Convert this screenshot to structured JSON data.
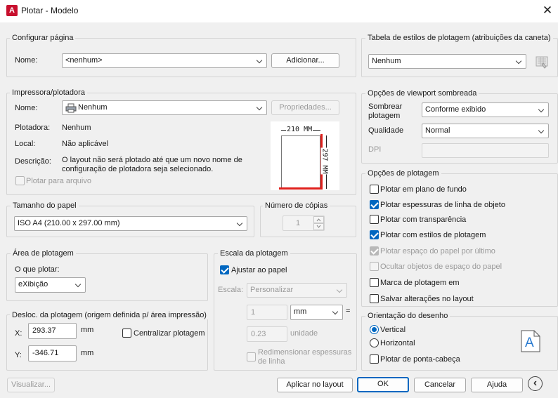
{
  "window": {
    "title": "Plotar - Modelo",
    "app_icon": "A",
    "close": "✕"
  },
  "page_setup": {
    "legend": "Configurar página",
    "name_label": "Nome:",
    "name_value": "<nenhum>",
    "add_button": "Adicionar..."
  },
  "printer": {
    "legend": "Impressora/plotadora",
    "name_label": "Nome:",
    "name_value": "Nenhum",
    "properties_button": "Propriedades...",
    "plotter_label": "Plotadora:",
    "plotter_value": "Nenhum",
    "location_label": "Local:",
    "location_value": "Não aplicável",
    "description_label": "Descrição:",
    "description_line1": "O layout não será plotado até que um novo nome de",
    "description_line2": "configuração de plotadora seja selecionado.",
    "plot_to_file": "Plotar para arquivo",
    "preview_width": "210 MM",
    "preview_height": "297 MM"
  },
  "paper_size": {
    "legend": "Tamanho do papel",
    "value": "ISO A4 (210.00 x 297.00 mm)"
  },
  "copies": {
    "legend": "Número de cópias",
    "value": "1"
  },
  "plot_area": {
    "legend": "Área de plotagem",
    "what_label": "O que plotar:",
    "what_value": "eXibição"
  },
  "offset": {
    "legend": "Desloc. da plotagem (origem definida p/ área impressão)",
    "x_label": "X:",
    "x_value": "293.37",
    "x_unit": "mm",
    "y_label": "Y:",
    "y_value": "-346.71",
    "y_unit": "mm",
    "center": "Centralizar plotagem"
  },
  "plot_scale": {
    "legend": "Escala da plotagem",
    "fit": "Ajustar ao papel",
    "fit_checked": true,
    "scale_label": "Escala:",
    "scale_value": "Personalizar",
    "value1": "1",
    "unit1": "mm",
    "equals": "=",
    "value2": "0.23",
    "unit2": "unidade",
    "scale_lineweights_line1": "Redimensionar espessuras",
    "scale_lineweights_line2": "de linha"
  },
  "style_table": {
    "legend": "Tabela de estilos de plotagem (atribuições da caneta)",
    "value": "Nenhum"
  },
  "shaded": {
    "legend": "Opções de viewport sombreada",
    "shade_label_line1": "Sombrear",
    "shade_label_line2": "plotagem",
    "shade_value": "Conforme exibido",
    "quality_label": "Qualidade",
    "quality_value": "Normal",
    "dpi_label": "DPI"
  },
  "plot_options": {
    "legend": "Opções de plotagem",
    "items": [
      {
        "label": "Plotar em plano de fundo",
        "checked": false,
        "disabled": false
      },
      {
        "label": "Plotar espessuras de linha de objeto",
        "checked": true,
        "disabled": false
      },
      {
        "label": "Plotar com transparência",
        "checked": false,
        "disabled": false
      },
      {
        "label": "Plotar com estilos de plotagem",
        "checked": true,
        "disabled": false
      },
      {
        "label": "Plotar espaço do papel por último",
        "checked": true,
        "disabled": true
      },
      {
        "label": "Ocultar objetos de espaço do papel",
        "checked": false,
        "disabled": true
      },
      {
        "label": "Marca de plotagem em",
        "checked": false,
        "disabled": false
      },
      {
        "label": "Salvar alterações no layout",
        "checked": false,
        "disabled": false
      }
    ]
  },
  "orientation": {
    "legend": "Orientação do desenho",
    "portrait": "Vertical",
    "landscape": "Horizontal",
    "upside_down": "Plotar de ponta-cabeça",
    "selected": "Vertical",
    "icon_letter": "A"
  },
  "footer": {
    "preview": "Visualizar...",
    "apply": "Aplicar no layout",
    "ok": "OK",
    "cancel": "Cancelar",
    "help": "Ajuda",
    "collapse": "‹"
  },
  "colors": {
    "accent": "#0067c0",
    "paper_edge": "#e0201c"
  }
}
